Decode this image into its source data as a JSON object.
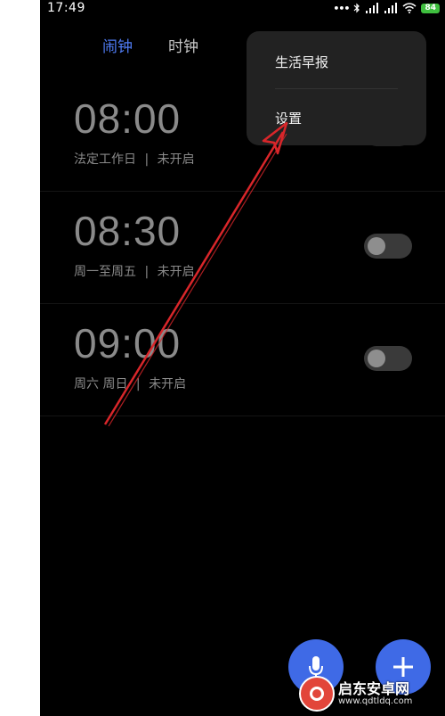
{
  "status_bar": {
    "time": "17:49",
    "signal_icons": [
      "more-dots-icon",
      "bluetooth-icon",
      "signal-icon",
      "signal-icon",
      "wifi-icon"
    ],
    "battery": "84"
  },
  "tabs": [
    {
      "label": "闹钟",
      "active": true
    },
    {
      "label": "时钟",
      "active": false
    }
  ],
  "alarms": [
    {
      "time": "08:00",
      "repeat": "法定工作日",
      "separator": "|",
      "state": "未开启",
      "enabled": false
    },
    {
      "time": "08:30",
      "repeat": "周一至周五",
      "separator": "|",
      "state": "未开启",
      "enabled": false
    },
    {
      "time": "09:00",
      "repeat": "周六 周日",
      "separator": "|",
      "state": "未开启",
      "enabled": false
    }
  ],
  "menu": {
    "items": [
      "生活早报",
      "设置"
    ]
  },
  "fabs": {
    "voice_icon": "microphone-icon",
    "add_icon": "plus-icon"
  },
  "watermark": {
    "title": "启东安卓网",
    "url": "www.qdtldq.com"
  },
  "colors": {
    "accent": "#4f7cf5",
    "fab": "#3f6ae6",
    "annotation_arrow": "#d9262a"
  }
}
